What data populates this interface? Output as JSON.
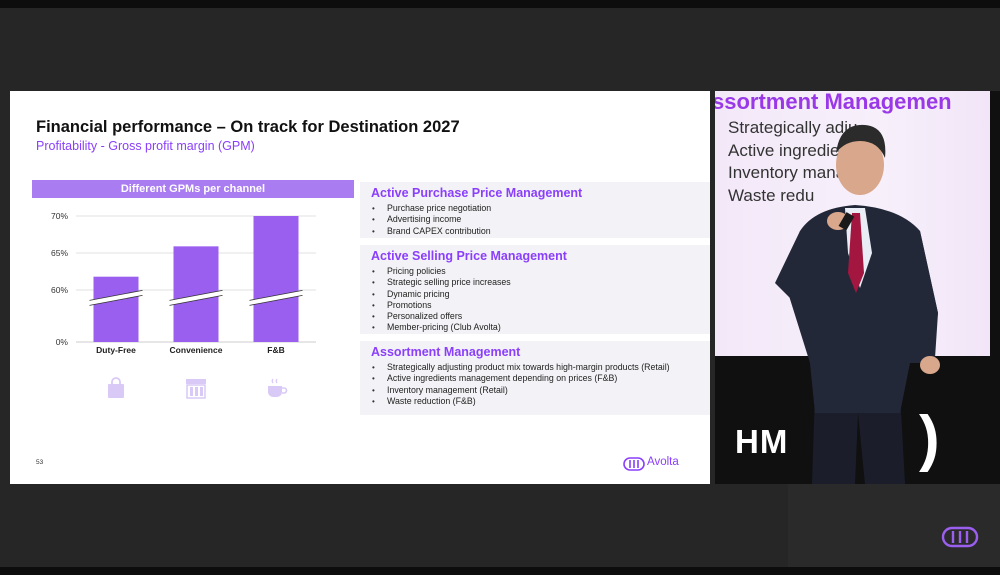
{
  "slide": {
    "title": "Financial performance – On track for Destination 2027",
    "subtitle": "Profitability - Gross profit margin (GPM)",
    "chart_header": "Different GPMs per channel",
    "page_number": "53",
    "brand": "Avolta",
    "icons": [
      "shopping-bag-icon",
      "storefront-icon",
      "coffee-cup-icon"
    ]
  },
  "chart_data": {
    "type": "bar",
    "title": "Different GPMs per channel",
    "categories": [
      "Duty-Free",
      "Convenience",
      "F&B"
    ],
    "values": [
      61.8,
      65.9,
      70
    ],
    "y_ticks": [
      "0%",
      "60%",
      "65%",
      "70%"
    ],
    "axis_break": true,
    "ylim": [
      0,
      70
    ],
    "grid": true,
    "bar_color": "#9b5ff0"
  },
  "panels": [
    {
      "title": "Active Purchase Price Management",
      "items": [
        "Purchase price negotiation",
        "Advertising income",
        "Brand CAPEX contribution"
      ]
    },
    {
      "title": "Active Selling Price Management",
      "items": [
        "Pricing policies",
        "Strategic selling price increases",
        "Dynamic pricing",
        "Promotions",
        "Personalized offers",
        "Member-pricing (Club Avolta)"
      ]
    },
    {
      "title": "Assortment Management",
      "items": [
        "Strategically adjusting product mix towards high-margin products (Retail)",
        "Active ingredients management depending on prices (F&B)",
        "Inventory management (Retail)",
        "Waste reduction (F&B)"
      ]
    }
  ],
  "video": {
    "screen_title": "ssortment Managemen",
    "screen_lines": [
      "Strategically adju",
      "Active ingredie",
      "Inventory manag",
      "Waste redu"
    ],
    "stage_logo": "HM",
    "stage_paren": ")"
  },
  "colors": {
    "accent": "#8a3ffc",
    "bar": "#9b5ff0",
    "header": "#a97cf2",
    "panel_bg": "#f3f2f6"
  }
}
